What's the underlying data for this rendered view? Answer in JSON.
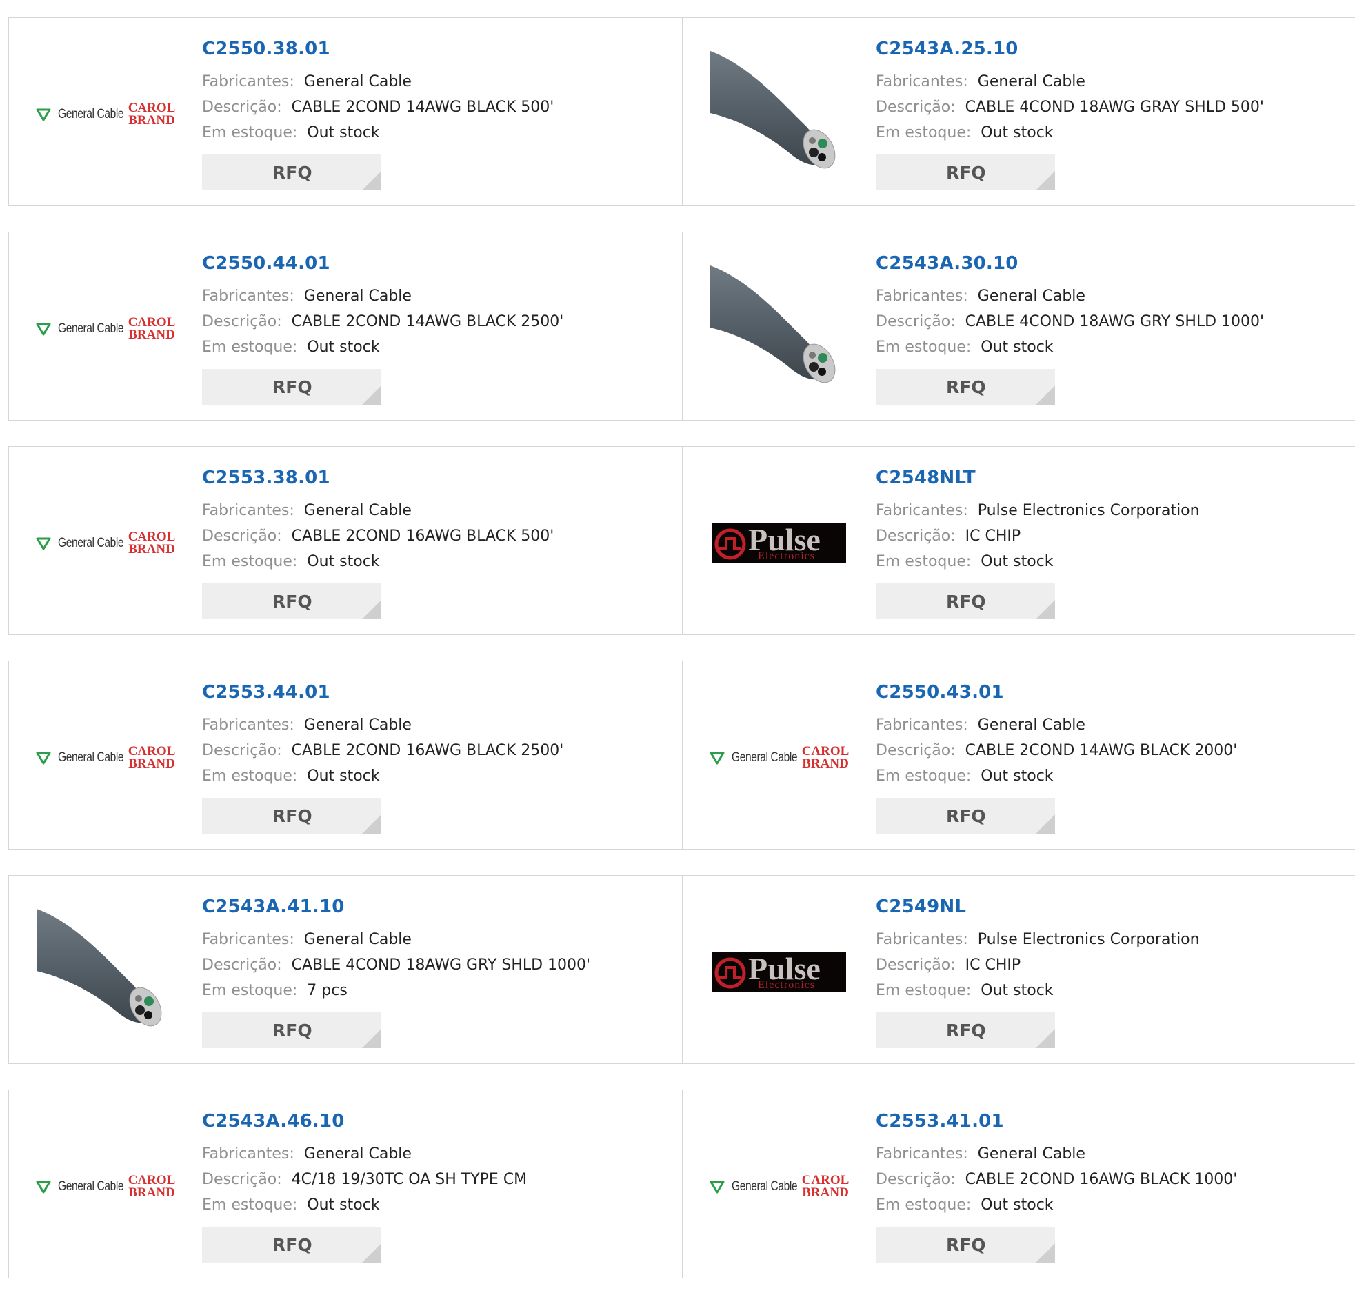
{
  "labels": {
    "manufacturer": "Fabricantes:",
    "description": "Descrição:",
    "stock": "Em estoque:",
    "rfq": "RFQ"
  },
  "logo_text": {
    "general_cable": "General Cable",
    "carol_1": "CAROL",
    "carol_2": "BRAND",
    "pulse": "Pulse",
    "pulse_sub": "Electronics"
  },
  "colors": {
    "link": "#1a66b3",
    "label": "#8f8f8f",
    "carol": "#d62f2f",
    "button": "#eeeeee"
  },
  "products": [
    {
      "pn": "C2550.38.01",
      "manufacturer": "General Cable",
      "description": "CABLE 2COND 14AWG BLACK 500'",
      "stock": "Out stock",
      "image": "general-cable-logo"
    },
    {
      "pn": "C2543A.25.10",
      "manufacturer": "General Cable",
      "description": "CABLE 4COND 18AWG GRAY SHLD 500'",
      "stock": "Out stock",
      "image": "cable-photo"
    },
    {
      "pn": "C2550.44.01",
      "manufacturer": "General Cable",
      "description": "CABLE 2COND 14AWG BLACK 2500'",
      "stock": "Out stock",
      "image": "general-cable-logo"
    },
    {
      "pn": "C2543A.30.10",
      "manufacturer": "General Cable",
      "description": "CABLE 4COND 18AWG GRY SHLD 1000'",
      "stock": "Out stock",
      "image": "cable-photo"
    },
    {
      "pn": "C2553.38.01",
      "manufacturer": "General Cable",
      "description": "CABLE 2COND 16AWG BLACK 500'",
      "stock": "Out stock",
      "image": "general-cable-logo"
    },
    {
      "pn": "C2548NLT",
      "manufacturer": "Pulse Electronics Corporation",
      "description": "IC CHIP",
      "stock": "Out stock",
      "image": "pulse-logo"
    },
    {
      "pn": "C2553.44.01",
      "manufacturer": "General Cable",
      "description": "CABLE 2COND 16AWG BLACK 2500'",
      "stock": "Out stock",
      "image": "general-cable-logo"
    },
    {
      "pn": "C2550.43.01",
      "manufacturer": "General Cable",
      "description": "CABLE 2COND 14AWG BLACK 2000'",
      "stock": "Out stock",
      "image": "general-cable-logo"
    },
    {
      "pn": "C2543A.41.10",
      "manufacturer": "General Cable",
      "description": "CABLE 4COND 18AWG GRY SHLD 1000'",
      "stock": "7 pcs",
      "image": "cable-photo"
    },
    {
      "pn": "C2549NL",
      "manufacturer": "Pulse Electronics Corporation",
      "description": "IC CHIP",
      "stock": "Out stock",
      "image": "pulse-logo"
    },
    {
      "pn": "C2543A.46.10",
      "manufacturer": "General Cable",
      "description": "4C/18 19/30TC OA SH TYPE CM",
      "stock": "Out stock",
      "image": "general-cable-logo"
    },
    {
      "pn": "C2553.41.01",
      "manufacturer": "General Cable",
      "description": "CABLE 2COND 16AWG BLACK 1000'",
      "stock": "Out stock",
      "image": "general-cable-logo"
    }
  ]
}
